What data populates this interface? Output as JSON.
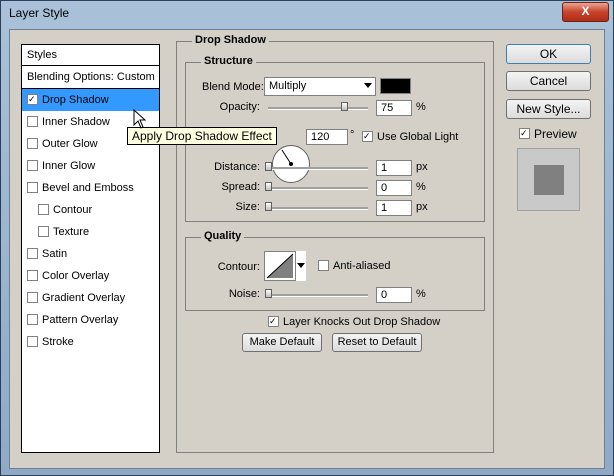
{
  "window": {
    "title": "Layer Style",
    "close_glyph": "X"
  },
  "styles_list": {
    "header": "Styles",
    "blending_options": "Blending Options: Custom",
    "items": [
      {
        "label": "Drop Shadow",
        "checked": true,
        "selected": true,
        "indent": false
      },
      {
        "label": "Inner Shadow",
        "checked": false,
        "selected": false,
        "indent": false
      },
      {
        "label": "Outer Glow",
        "checked": false,
        "selected": false,
        "indent": false
      },
      {
        "label": "Inner Glow",
        "checked": false,
        "selected": false,
        "indent": false
      },
      {
        "label": "Bevel and Emboss",
        "checked": false,
        "selected": false,
        "indent": false
      },
      {
        "label": "Contour",
        "checked": false,
        "selected": false,
        "indent": true
      },
      {
        "label": "Texture",
        "checked": false,
        "selected": false,
        "indent": true
      },
      {
        "label": "Satin",
        "checked": false,
        "selected": false,
        "indent": false
      },
      {
        "label": "Color Overlay",
        "checked": false,
        "selected": false,
        "indent": false
      },
      {
        "label": "Gradient Overlay",
        "checked": false,
        "selected": false,
        "indent": false
      },
      {
        "label": "Pattern Overlay",
        "checked": false,
        "selected": false,
        "indent": false
      },
      {
        "label": "Stroke",
        "checked": false,
        "selected": false,
        "indent": false
      }
    ]
  },
  "tooltip": "Apply Drop Shadow Effect",
  "drop_shadow": {
    "title": "Drop Shadow",
    "structure": {
      "title": "Structure",
      "blend_mode_label": "Blend Mode:",
      "blend_mode_value": "Multiply",
      "shadow_color": "#000000",
      "opacity_label": "Opacity:",
      "opacity_value": "75",
      "opacity_unit": "%",
      "angle_value": "120",
      "angle_unit": "°",
      "use_global_light_label": "Use Global Light",
      "use_global_light_checked": true,
      "distance_label": "Distance:",
      "distance_value": "1",
      "distance_unit": "px",
      "spread_label": "Spread:",
      "spread_value": "0",
      "spread_unit": "%",
      "size_label": "Size:",
      "size_value": "1",
      "size_unit": "px"
    },
    "quality": {
      "title": "Quality",
      "contour_label": "Contour:",
      "anti_aliased_label": "Anti-aliased",
      "anti_aliased_checked": false,
      "noise_label": "Noise:",
      "noise_value": "0",
      "noise_unit": "%"
    },
    "knocks_out_label": "Layer Knocks Out Drop Shadow",
    "knocks_out_checked": true,
    "make_default_label": "Make Default",
    "reset_default_label": "Reset to Default"
  },
  "buttons": {
    "ok": "OK",
    "cancel": "Cancel",
    "new_style": "New Style...",
    "preview_label": "Preview",
    "preview_checked": true
  },
  "colors": {
    "selection": "#3399ff",
    "dialog_bg": "#d4d0c8",
    "tooltip_bg": "#ffffe1"
  }
}
